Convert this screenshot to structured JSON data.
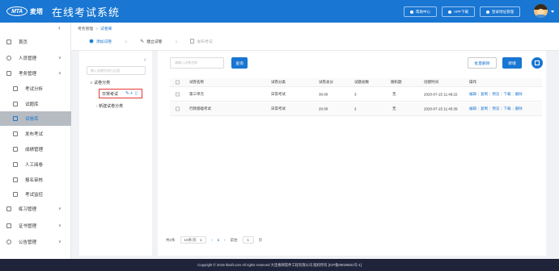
{
  "header": {
    "logo_text": "MTA",
    "brand": "麦塔",
    "title": "在线考试系统",
    "buttons": [
      "帮助中心",
      "APP下载",
      "登录地址管理"
    ]
  },
  "sidebar": {
    "collapse": "‹",
    "items": [
      {
        "label": "首页",
        "icon": "home-icon",
        "arrow": ""
      },
      {
        "label": "人员管理",
        "icon": "person-icon",
        "arrow": "∨"
      },
      {
        "label": "考务管理",
        "icon": "exam-icon",
        "arrow": "∧"
      },
      {
        "label": "考试分析",
        "icon": "analysis-icon",
        "arrow": ""
      },
      {
        "label": "试题库",
        "icon": "question-bank-icon",
        "arrow": ""
      },
      {
        "label": "试卷库",
        "icon": "paper-bank-icon",
        "arrow": ""
      },
      {
        "label": "发布考试",
        "icon": "publish-icon",
        "arrow": ""
      },
      {
        "label": "成绩管理",
        "icon": "score-icon",
        "arrow": ""
      },
      {
        "label": "人工阅卷",
        "icon": "grading-icon",
        "arrow": ""
      },
      {
        "label": "报名审核",
        "icon": "signup-icon",
        "arrow": ""
      },
      {
        "label": "考试监控",
        "icon": "monitor-icon",
        "arrow": ""
      },
      {
        "label": "练习管理",
        "icon": "practice-icon",
        "arrow": "∨"
      },
      {
        "label": "证书管理",
        "icon": "certificate-icon",
        "arrow": "∨"
      },
      {
        "label": "公告管理",
        "icon": "notice-icon",
        "arrow": "∨"
      }
    ]
  },
  "breadcrumb": {
    "parent": "考务管理",
    "current": "试卷库",
    "sep": ">"
  },
  "steps": [
    "添加试卷",
    "建立试卷",
    "发布考试"
  ],
  "tree": {
    "placeholder": "输入关键字进行过滤",
    "root": "试卷分类",
    "selected": "日常考试",
    "add_new": "新建试卷分类"
  },
  "toolbar": {
    "search_placeholder": "请输入试卷名称",
    "search_btn": "查询",
    "batch_delete": "批量删除",
    "new_btn": "新增"
  },
  "table": {
    "headers": [
      "试卷名称",
      "试卷分类",
      "试卷总分",
      "试题总数",
      "随机题",
      "创建时间",
      "操作"
    ],
    "rows": [
      {
        "name": "第三单元",
        "category": "日常考试",
        "score": "30.00",
        "count": "3",
        "random": "无",
        "time": "2020-07-15 11:49:22"
      },
      {
        "name": "行政基础考试",
        "category": "日常考试",
        "score": "20.00",
        "count": "2",
        "random": "无",
        "time": "2020-07-15 11:45:39"
      }
    ],
    "ops": [
      "编辑",
      "复制",
      "预览",
      "下载",
      "删除"
    ]
  },
  "pager": {
    "total": "共2条",
    "page_size": "10条/页",
    "prev": "‹",
    "current": "1",
    "next": "›",
    "goto_prefix": "前往",
    "goto_value": "1",
    "goto_suffix": "页"
  },
  "footer": "Copyright © 2019 Ilisoft.com All rights reserved 大连格网软件工程有限公司 版权所有 [ICP备09029841号-1]"
}
